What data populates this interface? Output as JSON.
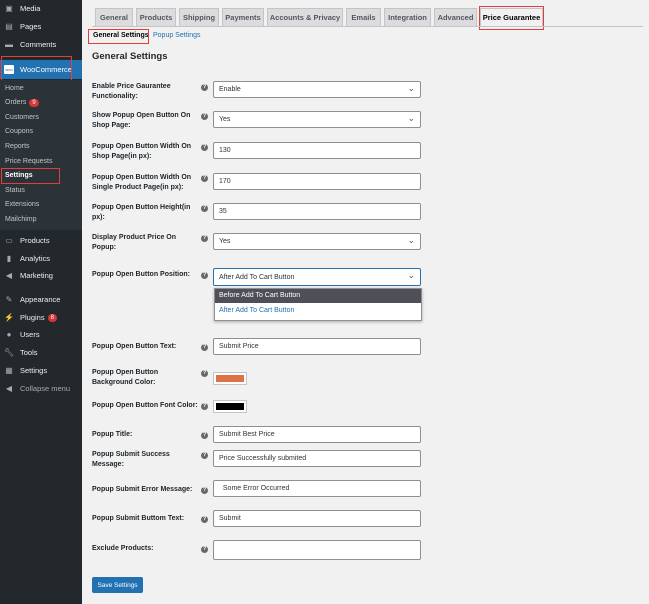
{
  "sidebar": {
    "top": [
      {
        "label": "Media",
        "icon": "media-icon"
      },
      {
        "label": "Pages",
        "icon": "pages-icon"
      },
      {
        "label": "Comments",
        "icon": "comments-icon"
      }
    ],
    "woocommerce": "WooCommerce",
    "sub": [
      {
        "label": "Home"
      },
      {
        "label": "Orders",
        "badge": "9"
      },
      {
        "label": "Customers"
      },
      {
        "label": "Coupons"
      },
      {
        "label": "Reports"
      },
      {
        "label": "Price Requests"
      },
      {
        "label": "Settings"
      },
      {
        "label": "Status"
      },
      {
        "label": "Extensions"
      },
      {
        "label": "Mailchimp"
      }
    ],
    "bottom": [
      {
        "label": "Products"
      },
      {
        "label": "Analytics"
      },
      {
        "label": "Marketing"
      },
      {
        "label": "Appearance"
      },
      {
        "label": "Plugins",
        "badge": "8"
      },
      {
        "label": "Users"
      },
      {
        "label": "Tools"
      },
      {
        "label": "Settings"
      },
      {
        "label": "Collapse menu"
      }
    ]
  },
  "tabs": [
    "General",
    "Products",
    "Shipping",
    "Payments",
    "Accounts & Privacy",
    "Emails",
    "Integration",
    "Advanced",
    "Price Guarantee"
  ],
  "subtabs": [
    "General Settings",
    "Popup Settings"
  ],
  "heading": "General Settings",
  "fields": [
    {
      "label": "Enable Price Gaurantee Functionality:",
      "value": "Enable"
    },
    {
      "label": "Show Popup Open Button On Shop Page:",
      "value": "Yes"
    },
    {
      "label": "Popup Open Button Width On Shop Page(in px):",
      "value": "130"
    },
    {
      "label": "Popup Open Button Width On Single Product Page(in px):",
      "value": "170"
    },
    {
      "label": "Popup Open Button Height(in px):",
      "value": "35"
    },
    {
      "label": "Display Product Price On Popup:",
      "value": "Yes"
    },
    {
      "label": "Popup Open Button Position:",
      "value": "After Add To Cart Button",
      "options": [
        "Before Add To Cart Button",
        "After Add To Cart Button"
      ]
    },
    {
      "label": "Popup Open Button Text:",
      "value": "Submit Price"
    },
    {
      "label": "Popup Open Button Background Color:",
      "color": "#e07048"
    },
    {
      "label": "Popup Open Button Font Color:",
      "color": "#000000"
    },
    {
      "label": "Popup Title:",
      "value": "Submit Best Price"
    },
    {
      "label": "Popup Submit Success Message:",
      "value": "Price Successfully submited"
    },
    {
      "label": "Popup Submit Error Message:",
      "value": "  Some Error Occurred"
    },
    {
      "label": "Popup Submit Buttom Text:",
      "value": "Submit"
    },
    {
      "label": "Exclude Products:",
      "value": ""
    }
  ],
  "save": "Save Settings",
  "help": "?"
}
